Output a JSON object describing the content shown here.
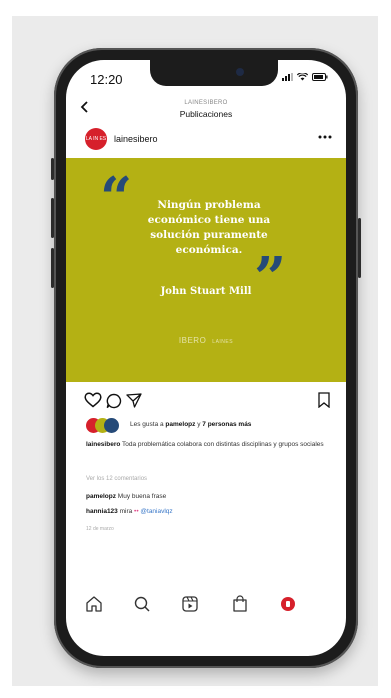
{
  "status": {
    "time": "12:20"
  },
  "header": {
    "account": "LAINESIBERO",
    "title": "Publicaciones"
  },
  "post": {
    "avatar_text": "LA IN ES",
    "username": "lainesibero",
    "quote": "Ningún problema económico tiene una solución puramente económica.",
    "author": "John Stuart Mill",
    "brand": "IBERO",
    "brand_small": "LAINES",
    "colors": {
      "background": "#b4b114",
      "quote_marks": "#254a78",
      "avatar": "#d6202b"
    }
  },
  "likes": {
    "prefix": "Les gusta a ",
    "user": "pamelopz",
    "connector": " y ",
    "others": "7 personas más"
  },
  "caption": {
    "user": "lainesibero",
    "text": " Toda problemática colabora con distintas disciplinas y grupos sociales"
  },
  "comments": {
    "view_all": "Ver los 12 comentarios",
    "items": [
      {
        "user": "pamelopz",
        "text": " Muy buena frase"
      },
      {
        "user": "hannia123",
        "text": " mira ",
        "emoji": "••",
        "mention": " @taniavlqz"
      }
    ]
  },
  "date": "12 de marzo",
  "icons": [
    "back-icon",
    "more-icon",
    "heart-icon",
    "comment-icon",
    "share-icon",
    "bookmark-icon",
    "home-icon",
    "search-icon",
    "reels-icon",
    "shop-icon",
    "profile-icon"
  ]
}
